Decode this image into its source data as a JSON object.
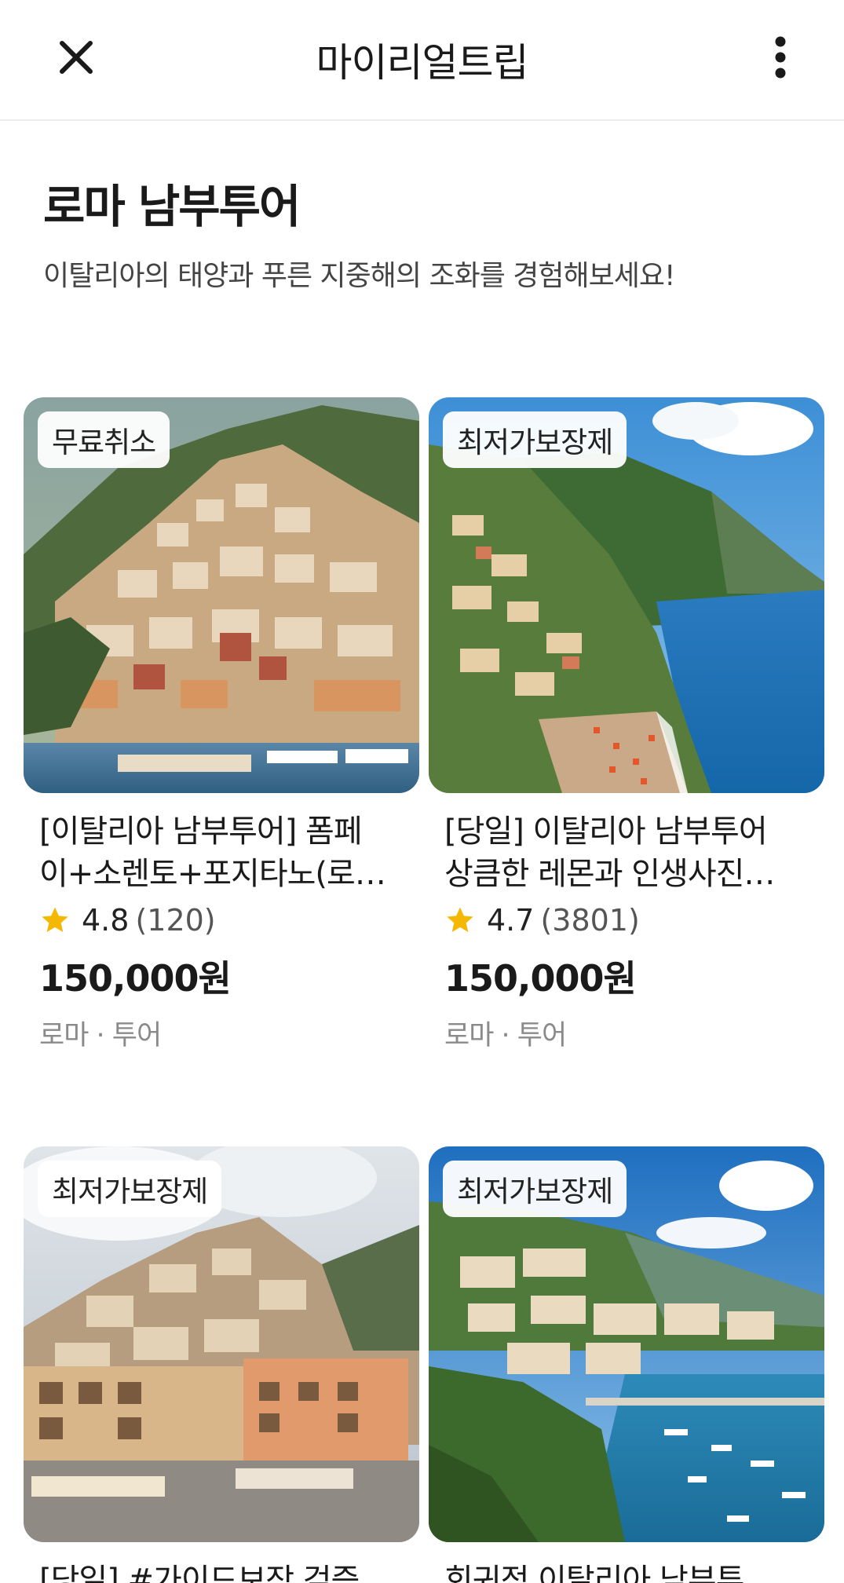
{
  "header": {
    "title": "마이리얼트립",
    "close_icon": "close-icon",
    "more_icon": "more-vertical-icon"
  },
  "section": {
    "title": "로마 남부투어",
    "subtitle": "이탈리아의 태양과 푸른 지중해의 조화를 경험해보세요!"
  },
  "colors": {
    "star": "#f5b800",
    "price": "#1a1a1a",
    "meta": "#8a8a8a"
  },
  "products": [
    {
      "badge": "무료취소",
      "title_line1": "[이탈리아 남부투어] 폼페",
      "title_line2": "이+소렌토+포지타노(로…",
      "rating": "4.8",
      "reviews": "(120)",
      "price": "150,000원",
      "meta": "로마 · 투어"
    },
    {
      "badge": "최저가보장제",
      "title_line1": "[당일] 이탈리아 남부투어",
      "title_line2": "상큼한 레몬과 인생사진…",
      "rating": "4.7",
      "reviews": "(3801)",
      "price": "150,000원",
      "meta": "로마 · 투어"
    },
    {
      "badge": "최저가보장제",
      "title_line1": "[당일] #가이드보장 검증",
      "title_line2": ""
    },
    {
      "badge": "최저가보장제",
      "title_line1": "회귀적 이탈리아 남부투",
      "title_line2": ""
    }
  ]
}
